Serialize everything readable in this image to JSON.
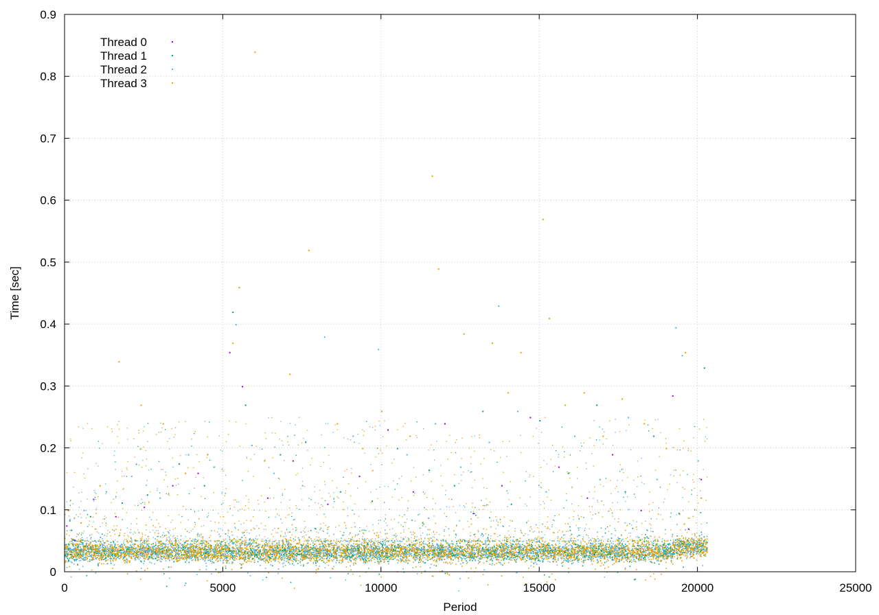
{
  "chart_data": {
    "type": "scatter",
    "title": "",
    "xlabel": "Period",
    "ylabel": "Time [sec]",
    "xlim": [
      0,
      25000
    ],
    "ylim": [
      0,
      0.9
    ],
    "xticks": [
      0,
      5000,
      10000,
      15000,
      20000,
      25000
    ],
    "yticks": [
      0,
      0.1,
      0.2,
      0.3,
      0.4,
      0.5,
      0.6,
      0.7,
      0.8,
      0.9
    ],
    "xtick_labels": [
      "0",
      "5000",
      "10000",
      "15000",
      "20000",
      "25000"
    ],
    "ytick_labels": [
      "0",
      "0.1",
      "0.2",
      "0.3",
      "0.4",
      "0.5",
      "0.6",
      "0.7",
      "0.8",
      "0.9"
    ],
    "grid": true,
    "legend_position": "top-left",
    "series": [
      {
        "name": "Thread 0",
        "color": "#9400d3",
        "points": [
          [
            50,
            0.075
          ],
          [
            300,
            0.052
          ],
          [
            900,
            0.118
          ],
          [
            1600,
            0.09
          ],
          [
            2500,
            0.105
          ],
          [
            3400,
            0.14
          ],
          [
            4200,
            0.16
          ],
          [
            5200,
            0.355
          ],
          [
            5600,
            0.3
          ],
          [
            6400,
            0.12
          ],
          [
            7200,
            0.18
          ],
          [
            8300,
            0.11
          ],
          [
            9300,
            0.155
          ],
          [
            10200,
            0.23
          ],
          [
            11000,
            0.13
          ],
          [
            12000,
            0.24
          ],
          [
            12900,
            0.095
          ],
          [
            13800,
            0.14
          ],
          [
            14700,
            0.25
          ],
          [
            15600,
            0.17
          ],
          [
            16500,
            0.12
          ],
          [
            17300,
            0.19
          ],
          [
            18200,
            0.1
          ],
          [
            19200,
            0.285
          ],
          [
            19700,
            0.07
          ],
          [
            20100,
            0.15
          ]
        ]
      },
      {
        "name": "Thread 1",
        "color": "#009e73",
        "points": [
          [
            200,
            0.068
          ],
          [
            800,
            0.09
          ],
          [
            1800,
            0.112
          ],
          [
            2600,
            0.125
          ],
          [
            3600,
            0.175
          ],
          [
            4400,
            0.14
          ],
          [
            5300,
            0.42
          ],
          [
            5700,
            0.27
          ],
          [
            6800,
            0.19
          ],
          [
            7600,
            0.21
          ],
          [
            8700,
            0.13
          ],
          [
            9700,
            0.115
          ],
          [
            10500,
            0.2
          ],
          [
            11500,
            0.165
          ],
          [
            12300,
            0.14
          ],
          [
            13200,
            0.26
          ],
          [
            14100,
            0.11
          ],
          [
            15000,
            0.245
          ],
          [
            15900,
            0.16
          ],
          [
            16800,
            0.27
          ],
          [
            17700,
            0.13
          ],
          [
            18600,
            0.22
          ],
          [
            19400,
            0.095
          ],
          [
            20200,
            0.33
          ]
        ]
      },
      {
        "name": "Thread 2",
        "color": "#56b4e9",
        "points": [
          [
            150,
            0.085
          ],
          [
            600,
            0.1
          ],
          [
            1300,
            0.13
          ],
          [
            2100,
            0.155
          ],
          [
            3000,
            0.12
          ],
          [
            3900,
            0.19
          ],
          [
            4700,
            0.17
          ],
          [
            5400,
            0.4
          ],
          [
            5900,
            0.205
          ],
          [
            6600,
            0.16
          ],
          [
            7500,
            0.14
          ],
          [
            8200,
            0.38
          ],
          [
            9100,
            0.22
          ],
          [
            9900,
            0.36
          ],
          [
            10800,
            0.19
          ],
          [
            11700,
            0.24
          ],
          [
            12500,
            0.17
          ],
          [
            13400,
            0.21
          ],
          [
            13700,
            0.43
          ],
          [
            14300,
            0.26
          ],
          [
            15200,
            0.13
          ],
          [
            16100,
            0.22
          ],
          [
            16900,
            0.15
          ],
          [
            17800,
            0.25
          ],
          [
            18700,
            0.15
          ],
          [
            19300,
            0.395
          ],
          [
            19500,
            0.35
          ],
          [
            20000,
            0.18
          ]
        ]
      },
      {
        "name": "Thread 3",
        "color": "#e69f00",
        "points": [
          [
            100,
            0.1
          ],
          [
            500,
            0.08
          ],
          [
            1100,
            0.14
          ],
          [
            1700,
            0.34
          ],
          [
            2400,
            0.27
          ],
          [
            3100,
            0.24
          ],
          [
            3800,
            0.16
          ],
          [
            4500,
            0.19
          ],
          [
            5300,
            0.37
          ],
          [
            5500,
            0.46
          ],
          [
            6000,
            0.84
          ],
          [
            6300,
            0.18
          ],
          [
            7100,
            0.32
          ],
          [
            7700,
            0.52
          ],
          [
            8600,
            0.24
          ],
          [
            9400,
            0.2
          ],
          [
            10000,
            0.26
          ],
          [
            10900,
            0.22
          ],
          [
            11600,
            0.64
          ],
          [
            11800,
            0.49
          ],
          [
            12600,
            0.385
          ],
          [
            13500,
            0.37
          ],
          [
            14000,
            0.29
          ],
          [
            14400,
            0.355
          ],
          [
            15100,
            0.57
          ],
          [
            15300,
            0.41
          ],
          [
            15800,
            0.27
          ],
          [
            16400,
            0.29
          ],
          [
            17000,
            0.22
          ],
          [
            17600,
            0.28
          ],
          [
            18300,
            0.24
          ],
          [
            19000,
            0.2
          ],
          [
            19600,
            0.355
          ],
          [
            20100,
            0.12
          ]
        ]
      }
    ],
    "dense_band": {
      "x_range": [
        0,
        20300
      ],
      "y_center": 0.033,
      "y_spread": 0.012,
      "x_step_end_rise": [
        19200,
        0.045
      ]
    }
  }
}
